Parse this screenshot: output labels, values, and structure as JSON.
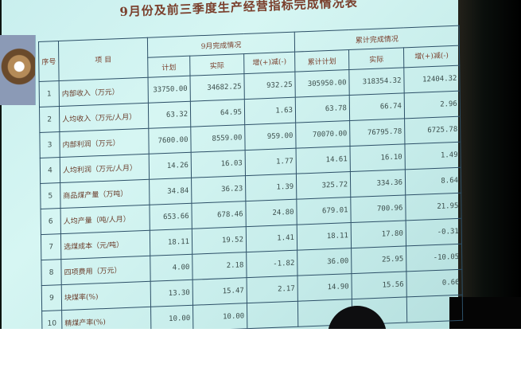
{
  "title": "9月份及前三季度生产经营指标完成情况表",
  "header": {
    "seq": "序号",
    "item": "项    目",
    "sep": "9月完成情况",
    "cum": "累计完成情况",
    "plan": "计划",
    "actual": "实际",
    "diff": "增(+)减(-)",
    "cum_plan": "累计计划",
    "cum_actual": "实际",
    "cum_diff": "增(+)减(-)"
  },
  "rows": [
    {
      "no": "1",
      "item": "内部收入（万元）",
      "plan": "33750.00",
      "actual": "34682.25",
      "diff": "932.25",
      "cum_plan": "305950.00",
      "cum_actual": "318354.32",
      "cum_diff": "12404.32"
    },
    {
      "no": "2",
      "item": "人均收入（万元/人月）",
      "plan": "63.32",
      "actual": "64.95",
      "diff": "1.63",
      "cum_plan": "63.78",
      "cum_actual": "66.74",
      "cum_diff": "2.96"
    },
    {
      "no": "3",
      "item": "内部利润（万元）",
      "plan": "7600.00",
      "actual": "8559.00",
      "diff": "959.00",
      "cum_plan": "70070.00",
      "cum_actual": "76795.78",
      "cum_diff": "6725.78"
    },
    {
      "no": "4",
      "item": "人均利润（万元/人月）",
      "plan": "14.26",
      "actual": "16.03",
      "diff": "1.77",
      "cum_plan": "14.61",
      "cum_actual": "16.10",
      "cum_diff": "1.49"
    },
    {
      "no": "5",
      "item": "商品煤产量（万吨）",
      "plan": "34.84",
      "actual": "36.23",
      "diff": "1.39",
      "cum_plan": "325.72",
      "cum_actual": "334.36",
      "cum_diff": "8.64"
    },
    {
      "no": "6",
      "item": "人均产量（吨/人月）",
      "plan": "653.66",
      "actual": "678.46",
      "diff": "24.80",
      "cum_plan": "679.01",
      "cum_actual": "700.96",
      "cum_diff": "21.95"
    },
    {
      "no": "7",
      "item": "选煤成本（元/吨）",
      "plan": "18.11",
      "actual": "19.52",
      "diff": "1.41",
      "cum_plan": "18.11",
      "cum_actual": "17.80",
      "cum_diff": "-0.31"
    },
    {
      "no": "8",
      "item": "四项费用（万元）",
      "plan": "4.00",
      "actual": "2.18",
      "diff": "-1.82",
      "cum_plan": "36.00",
      "cum_actual": "25.95",
      "cum_diff": "-10.05"
    },
    {
      "no": "9",
      "item": "块煤率(%)",
      "plan": "13.30",
      "actual": "15.47",
      "diff": "2.17",
      "cum_plan": "14.90",
      "cum_actual": "15.56",
      "cum_diff": "0.66"
    },
    {
      "no": "10",
      "item": "精煤产率(%)",
      "plan": "10.00",
      "actual": "10.00",
      "diff": "",
      "cum_plan": "",
      "cum_actual": "",
      "cum_diff": ""
    }
  ]
}
